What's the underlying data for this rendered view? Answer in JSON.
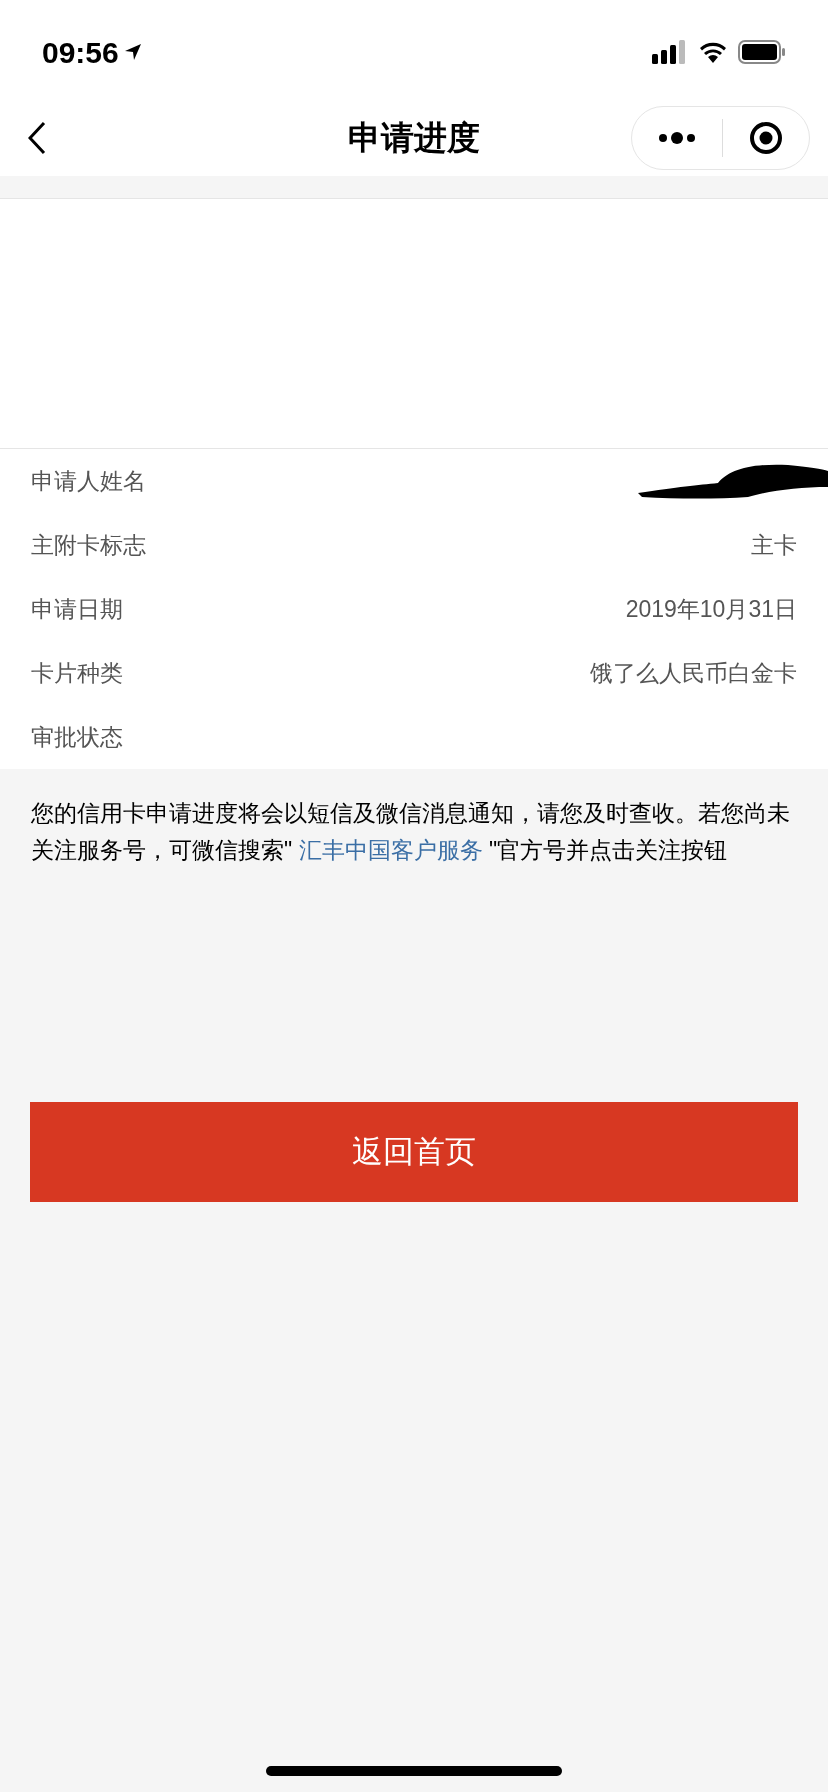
{
  "status_bar": {
    "time": "09:56"
  },
  "nav": {
    "title": "申请进度"
  },
  "rows": [
    {
      "label": "申请人姓名",
      "redacted": true
    },
    {
      "label": "主附卡标志",
      "value": "主卡",
      "redacted": false
    },
    {
      "label": "申请日期",
      "value": "2019年10月31日",
      "redacted": false
    },
    {
      "label": "卡片种类",
      "value": "饿了么人民币白金卡",
      "redacted": false
    },
    {
      "label": "审批状态",
      "redacted": false
    }
  ],
  "notice": {
    "before": "您的信用卡申请进度将会以短信及微信消息通知，请您及时查收。若您尚未关注服务号，可微信搜索\" ",
    "link": "汇丰中国客户服务",
    "after": " \"官方号并点击关注按钮"
  },
  "button": {
    "label": "返回首页"
  }
}
